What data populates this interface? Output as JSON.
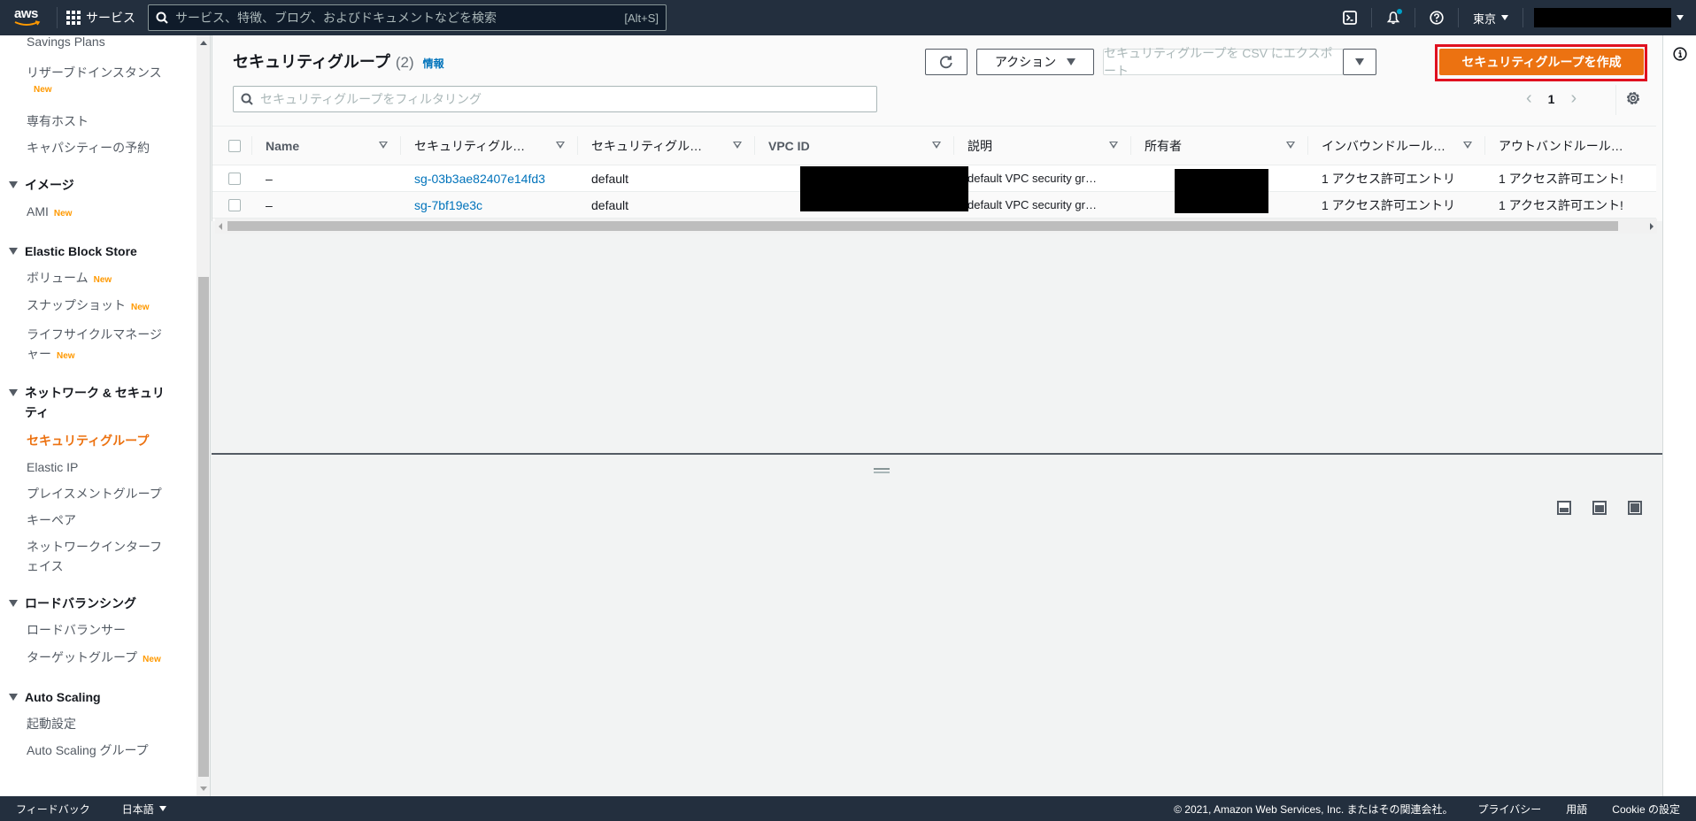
{
  "topnav": {
    "logo_text": "aws",
    "services_label": "サービス",
    "search_placeholder": "サービス、特徴、ブログ、およびドキュメントなどを検索",
    "search_shortcut": "[Alt+S]",
    "region_label": "東京",
    "icons": [
      "cloudshell-icon",
      "bell-icon",
      "help-icon"
    ]
  },
  "sidebar": {
    "items": [
      {
        "label": "Savings Plans"
      },
      {
        "label": "リザーブドインスタンス",
        "badge": "New"
      },
      {
        "label": "専有ホスト"
      },
      {
        "label": "キャパシティーの予約"
      }
    ],
    "sections": [
      {
        "title": "イメージ",
        "items": [
          {
            "label": "AMI",
            "badge": "New"
          }
        ]
      },
      {
        "title": "Elastic Block Store",
        "items": [
          {
            "label": "ボリューム",
            "badge": "New"
          },
          {
            "label": "スナップショット",
            "badge": "New"
          },
          {
            "label": "ライフサイクルマネージャー",
            "line1": "ライフサイクルマネージ",
            "line2": "ャー",
            "badge": "New"
          }
        ]
      },
      {
        "title": "ネットワーク & セキュリティ",
        "title_line1": "ネットワーク & セキュリ",
        "title_line2": "ティ",
        "items": [
          {
            "label": "セキュリティグループ",
            "active": true
          },
          {
            "label": "Elastic IP"
          },
          {
            "label": "プレイスメントグループ"
          },
          {
            "label": "キーペア"
          },
          {
            "label": "ネットワークインターフェイス",
            "line1": "ネットワークインターフ",
            "line2": "ェイス"
          }
        ]
      },
      {
        "title": "ロードバランシング",
        "items": [
          {
            "label": "ロードバランサー"
          },
          {
            "label": "ターゲットグループ",
            "badge": "New"
          }
        ]
      },
      {
        "title": "Auto Scaling",
        "items": [
          {
            "label": "起動設定"
          },
          {
            "label": "Auto Scaling グループ"
          }
        ]
      }
    ]
  },
  "main": {
    "title": "セキュリティグループ",
    "count": "(2)",
    "info_link": "情報",
    "buttons": {
      "refresh": "refresh",
      "actions": "アクション",
      "export": "セキュリティグループを CSV にエクスポート",
      "create": "セキュリティグループを作成"
    },
    "filter_placeholder": "セキュリティグループをフィルタリング",
    "pagination": {
      "current_page": "1"
    },
    "table": {
      "columns": [
        "Name",
        "セキュリティグル…",
        "セキュリティグル…",
        "VPC ID",
        "説明",
        "所有者",
        "インバウンドルール…",
        "アウトバンドルール…"
      ],
      "rows": [
        {
          "name": "–",
          "sg_id": "sg-03b3ae82407e14fd3",
          "sg_name": "default",
          "vpc_id": "[redacted]",
          "description": "default VPC security gr…",
          "owner": "[redacted]",
          "inbound": "1 アクセス許可エントリ",
          "outbound": "1 アクセス許可エント!"
        },
        {
          "name": "–",
          "sg_id": "sg-7bf19e3c",
          "sg_name": "default",
          "vpc_id": "[redacted]",
          "description": "default VPC security gr…",
          "owner": "[redacted]",
          "inbound": "1 アクセス許可エントリ",
          "outbound": "1 アクセス許可エント!"
        }
      ]
    }
  },
  "footer": {
    "feedback": "フィードバック",
    "language": "日本語",
    "copyright": "© 2021, Amazon Web Services, Inc. またはその関連会社。",
    "privacy": "プライバシー",
    "terms": "用語",
    "cookie": "Cookie の設定"
  },
  "colors": {
    "nav_bg": "#232f3e",
    "accent_orange": "#ec7211",
    "link_blue": "#0073bb",
    "highlight_red": "#e0101f",
    "new_badge": "#ff9900"
  }
}
